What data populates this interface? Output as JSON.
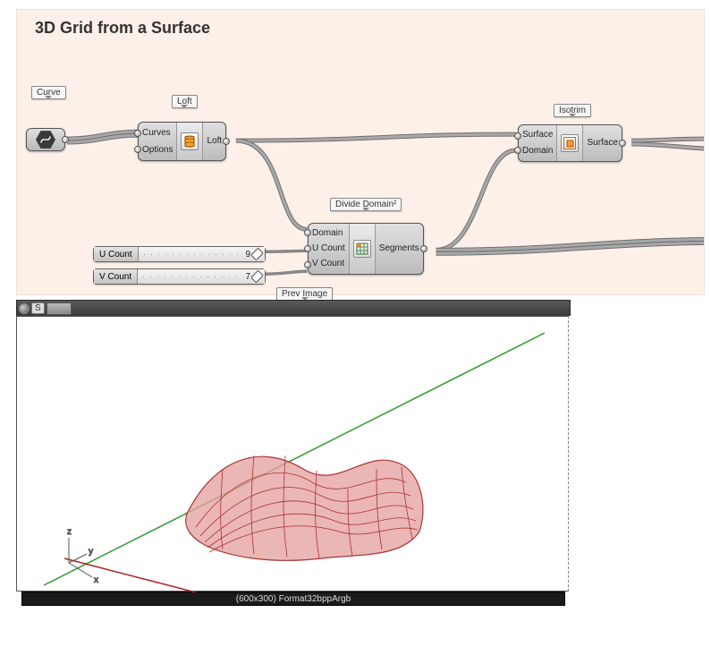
{
  "title": "3D Grid from a Surface",
  "tags": {
    "curve": "Curve",
    "loft": "Loft",
    "divide": "Divide Domain²",
    "isotrim": "Isotrim",
    "prev": "Prev Image"
  },
  "loft": {
    "in": {
      "curves": "Curves",
      "options": "Options"
    },
    "out": "Loft"
  },
  "divide": {
    "in": {
      "domain": "Domain",
      "u": "U Count",
      "v": "V Count"
    },
    "out": "Segments"
  },
  "isotrim": {
    "in": {
      "surface": "Surface",
      "domain": "Domain"
    },
    "out": "Surface"
  },
  "sliders": {
    "u": {
      "label": "U Count",
      "value": "9"
    },
    "v": {
      "label": "V Count",
      "value": "7"
    }
  },
  "preview": {
    "header_label": "S",
    "footer": "(600x300) Format32bppArgb",
    "axes": {
      "x": "x",
      "y": "y",
      "z": "z"
    }
  }
}
